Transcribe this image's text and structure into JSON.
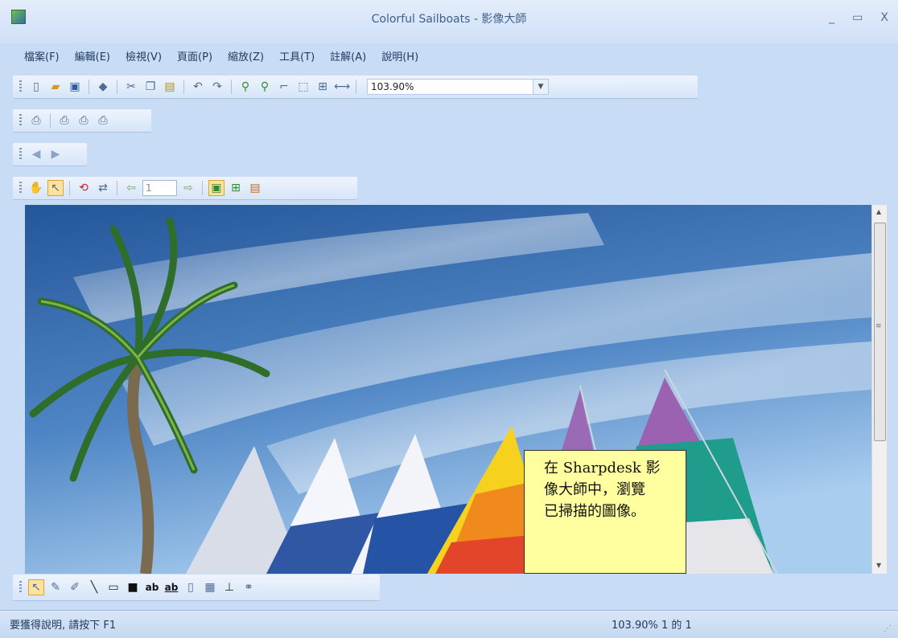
{
  "window": {
    "title": "Colorful Sailboats - 影像大師",
    "minimize": "_",
    "maximize": "▭",
    "close": "X"
  },
  "menu": [
    "檔案(F)",
    "編輯(E)",
    "檢視(V)",
    "頁面(P)",
    "縮放(Z)",
    "工具(T)",
    "註解(A)",
    "說明(H)"
  ],
  "toolbar": {
    "zoom_value": "103.90%",
    "page_number": "1"
  },
  "callout": {
    "lines": [
      "在 Sharpdesk 影",
      "像大師中，瀏覽",
      "已掃描的圖像。"
    ]
  },
  "bottom_toolbar": {
    "text_tool_label": "ab",
    "highlight_text_label": "ab"
  },
  "status": {
    "help_text": "要獲得說明, 請按下 F1",
    "zoom_page": "103.90% 1 的 1"
  },
  "colors": {
    "accent_active": "#ffe29b",
    "callout_bg": "#ffffa0",
    "sky_top": "#2e5f9c",
    "sky_light": "#a7c8ea"
  }
}
